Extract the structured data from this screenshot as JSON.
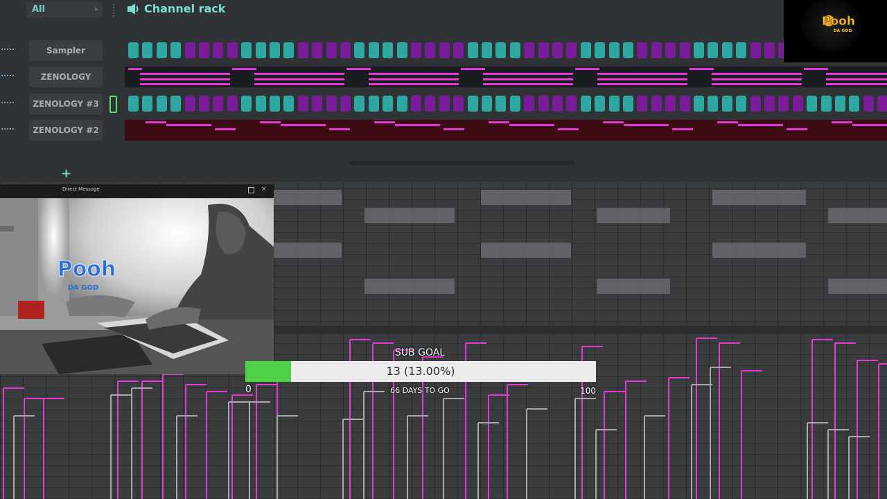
{
  "rack": {
    "filter": "All",
    "title": "Channel rack",
    "add_symbol": "+"
  },
  "channels": [
    {
      "name": "Sampler"
    },
    {
      "name": "ZENOLOGY"
    },
    {
      "name": "ZENOLOGY #3"
    },
    {
      "name": "ZENOLOGY #2"
    }
  ],
  "webcam": {
    "title": "Direct Message",
    "close_symbol": "×"
  },
  "logo": {
    "text_main": "Pooh",
    "text_sub": "DA GOD"
  },
  "sub_goal": {
    "title": "SUB GOAL",
    "value": "13 (13.00%)",
    "min": "0",
    "max": "100",
    "days": "66 DAYS TO GO",
    "progress_fraction": 0.13
  },
  "colors": {
    "accent_teal": "#6fd1c0",
    "step_teal": "#2fa7a3",
    "step_purple": "#7a1c9a",
    "note_magenta": "#e33ad6",
    "goal_green": "#4fd146"
  }
}
